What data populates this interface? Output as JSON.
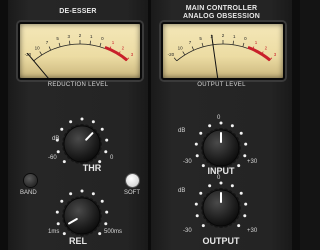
{
  "left_section": {
    "title": "DE-ESSER",
    "meter_caption": "REDUCTION LEVEL",
    "meter": {
      "scale_labels": [
        "-20",
        "10",
        "7",
        "5",
        "3",
        "2",
        "1",
        "0",
        "1",
        "2",
        "3"
      ]
    },
    "thr_knob": {
      "label": "THR",
      "unit": "dB",
      "min": "-60",
      "max": "0"
    },
    "band_button": {
      "label": "BAND"
    },
    "soft_button": {
      "label": "SOFT"
    },
    "rel_knob": {
      "label": "REL",
      "min": "1ms",
      "max": "500ms"
    }
  },
  "right_section": {
    "title_line1": "MAIN CONTROLLER",
    "title_line2": "ANALOG OBSESSION",
    "meter_caption": "OUTPUT LEVEL",
    "meter": {
      "scale_labels": [
        "-20",
        "10",
        "7",
        "5",
        "3",
        "2",
        "1",
        "0",
        "1",
        "2",
        "3"
      ]
    },
    "input_knob": {
      "label": "INPUT",
      "unit": "dB",
      "top": "0",
      "min": "-30",
      "max": "+30"
    },
    "output_knob": {
      "label": "OUTPUT",
      "unit": "dB",
      "top": "0",
      "min": "-30",
      "max": "+30"
    }
  },
  "colors": {
    "meter_face": "#efe0a8",
    "meter_red_zone": "#c8202a",
    "panel": "#242424"
  }
}
